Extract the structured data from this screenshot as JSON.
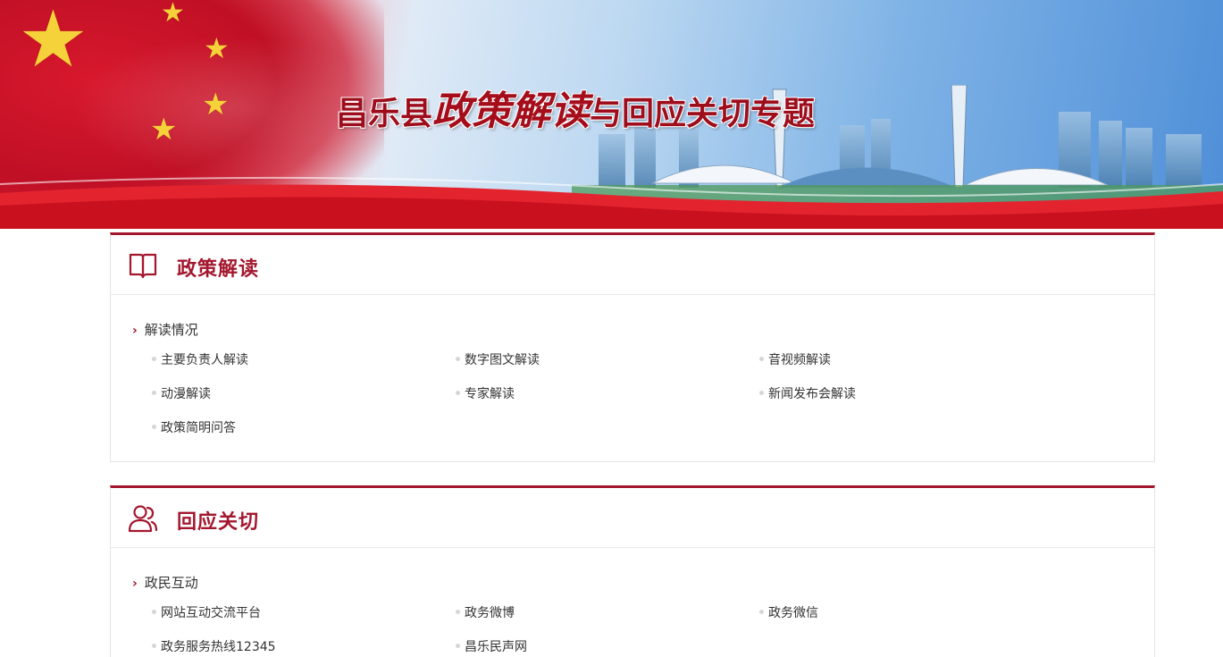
{
  "banner": {
    "title_part1": "昌乐县",
    "title_part2": "政策解读",
    "title_part3": "与回应关切专题"
  },
  "sections": [
    {
      "title": "政策解读",
      "icon": "book-icon",
      "subsection": "解读情况",
      "links": [
        "主要负责人解读",
        "数字图文解读",
        "音视频解读",
        "动漫解读",
        "专家解读",
        "新闻发布会解读",
        "政策简明问答"
      ]
    },
    {
      "title": "回应关切",
      "icon": "users-icon",
      "subsection": "政民互动",
      "links": [
        "网站互动交流平台",
        "政务微博",
        "政务微信",
        "政务服务热线12345",
        "昌乐民声网"
      ]
    }
  ],
  "colors": {
    "accent": "#a3172e",
    "flag_red": "#c8102e",
    "sky_blue": "#7fb3e6"
  }
}
